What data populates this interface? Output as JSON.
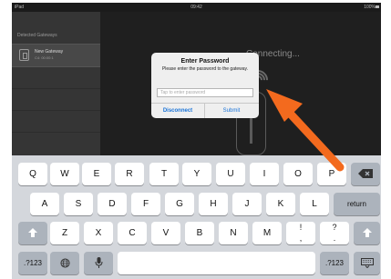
{
  "status_bar": {
    "carrier": "iPad",
    "time": "09:42",
    "battery": "100%"
  },
  "sidebar": {
    "header": "Detected Gateways",
    "gateway": {
      "name": "New Gateway",
      "subtitle": "C4: 00:00:1"
    }
  },
  "main": {
    "connecting_text": "Connecting..."
  },
  "dialog": {
    "title": "Enter Password",
    "message": "Please enter the password to the gateway.",
    "input_placeholder": "Tap to enter password",
    "disconnect_label": "Disconnect",
    "submit_label": "Submit"
  },
  "keyboard": {
    "row1": [
      "Q",
      "W",
      "E",
      "R",
      "T",
      "Y",
      "U",
      "I",
      "O",
      "P"
    ],
    "row2": [
      "A",
      "S",
      "D",
      "F",
      "G",
      "H",
      "J",
      "K",
      "L"
    ],
    "row3": [
      "Z",
      "X",
      "C",
      "V",
      "B",
      "N",
      "M",
      "!",
      "?"
    ],
    "row3_secondary": [
      ",",
      "."
    ],
    "return_label": "return",
    "numbers_label": ".?123",
    "icons": [
      "delete-icon",
      "shift-icon",
      "globe-icon",
      "microphone-icon",
      "keyboard-hide-icon"
    ]
  },
  "colors": {
    "accent": "#1a74d8",
    "annotation_arrow": "#f36a1e",
    "keyboard_bg": "#d4d7dc"
  }
}
